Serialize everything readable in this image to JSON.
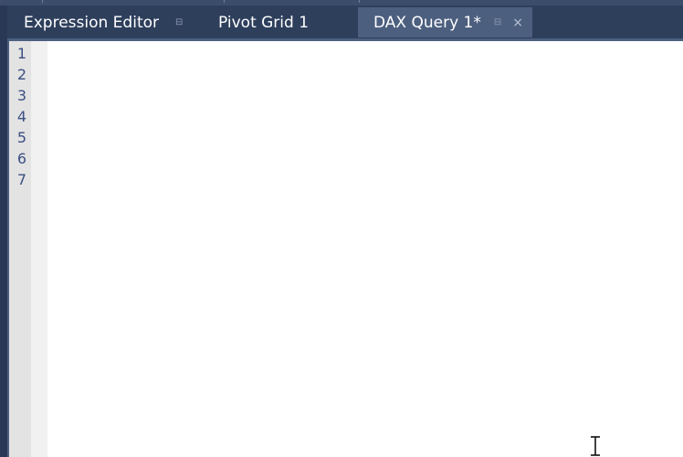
{
  "tabs": [
    {
      "label": "Expression Editor",
      "pin": "⊟",
      "active": false
    },
    {
      "label": "Pivot Grid 1",
      "active": false
    },
    {
      "label": "DAX Query 1*",
      "pin": "⊟",
      "close": "×",
      "active": true
    }
  ],
  "editor": {
    "line_numbers": [
      "1",
      "2",
      "3",
      "4",
      "5",
      "6",
      "7"
    ],
    "content": ""
  },
  "colors": {
    "chrome": "#293955",
    "tab_active": "#4c5f7f",
    "line_number": "#3b4f82",
    "gutter": "#e3e3e3"
  }
}
